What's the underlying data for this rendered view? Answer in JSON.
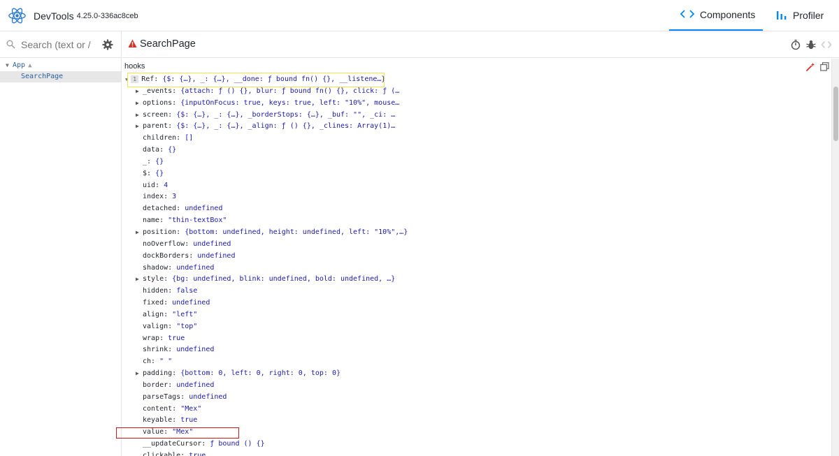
{
  "app": {
    "title": "DevTools",
    "version": "4.25.0-336ac8ceb"
  },
  "tabs": [
    {
      "label": "Components",
      "icon": "code-brackets-icon",
      "active": true
    },
    {
      "label": "Profiler",
      "icon": "bar-chart-icon",
      "active": false
    }
  ],
  "left": {
    "search_placeholder": "Search (text or /regex/)",
    "tree": [
      {
        "label": "App",
        "expanded": true,
        "warning": true
      },
      {
        "label": "SearchPage",
        "selected": true
      }
    ]
  },
  "inspector": {
    "component_name": "SearchPage",
    "section_label": "hooks",
    "ref": {
      "badge": "1",
      "key": "Ref:",
      "value": "{$: {…}, _: {…}, __done: ƒ bound fn() {}, __listene…}"
    },
    "props": [
      {
        "key": "_events:",
        "value": "{attach: ƒ () {}, blur: ƒ bound fn() {}, click: ƒ (…",
        "expandable": true
      },
      {
        "key": "options:",
        "value": "{inputOnFocus: true, keys: true, left: \"10%\", mouse…",
        "expandable": true
      },
      {
        "key": "screen:",
        "value": "{$: {…}, _: {…}, _borderStops: {…}, _buf: \"\", _ci: …",
        "expandable": true
      },
      {
        "key": "parent:",
        "value": "{$: {…}, _: {…}, _align: ƒ () {}, _clines: Array(1)…",
        "expandable": true
      },
      {
        "key": "children:",
        "value": "[]",
        "expandable": false
      },
      {
        "key": "data:",
        "value": "{}",
        "expandable": false
      },
      {
        "key": "_:",
        "value": "{}",
        "expandable": false
      },
      {
        "key": "$:",
        "value": "{}",
        "expandable": false
      },
      {
        "key": "uid:",
        "value": "4",
        "expandable": false
      },
      {
        "key": "index:",
        "value": "3",
        "expandable": false
      },
      {
        "key": "detached:",
        "value": "undefined",
        "expandable": false
      },
      {
        "key": "name:",
        "value": "\"thin-textBox\"",
        "expandable": false
      },
      {
        "key": "position:",
        "value": "{bottom: undefined, height: undefined, left: \"10%\",…}",
        "expandable": true
      },
      {
        "key": "noOverflow:",
        "value": "undefined",
        "expandable": false
      },
      {
        "key": "dockBorders:",
        "value": "undefined",
        "expandable": false
      },
      {
        "key": "shadow:",
        "value": "undefined",
        "expandable": false
      },
      {
        "key": "style:",
        "value": "{bg: undefined, blink: undefined, bold: undefined, …}",
        "expandable": true
      },
      {
        "key": "hidden:",
        "value": "false",
        "expandable": false
      },
      {
        "key": "fixed:",
        "value": "undefined",
        "expandable": false
      },
      {
        "key": "align:",
        "value": "\"left\"",
        "expandable": false
      },
      {
        "key": "valign:",
        "value": "\"top\"",
        "expandable": false
      },
      {
        "key": "wrap:",
        "value": "true",
        "expandable": false
      },
      {
        "key": "shrink:",
        "value": "undefined",
        "expandable": false
      },
      {
        "key": "ch:",
        "value": "\" \"",
        "expandable": false
      },
      {
        "key": "padding:",
        "value": "{bottom: 0, left: 0, right: 0, top: 0}",
        "expandable": true
      },
      {
        "key": "border:",
        "value": "undefined",
        "expandable": false
      },
      {
        "key": "parseTags:",
        "value": "undefined",
        "expandable": false
      },
      {
        "key": "content:",
        "value": "\"Mex\"",
        "expandable": false
      },
      {
        "key": "keyable:",
        "value": "true",
        "expandable": false
      },
      {
        "key": "value:",
        "value": "\"Mex\"",
        "expandable": false
      },
      {
        "key": "__updateCursor:",
        "value": "ƒ bound () {}",
        "expandable": false
      },
      {
        "key": "clickable:",
        "value": "true",
        "expandable": false
      }
    ]
  },
  "colors": {
    "accent": "#0088fa",
    "value_text": "#1a1aa6",
    "highlight_yellow": "#f2e34a",
    "highlight_red": "#d21818",
    "warning": "#d93025"
  }
}
